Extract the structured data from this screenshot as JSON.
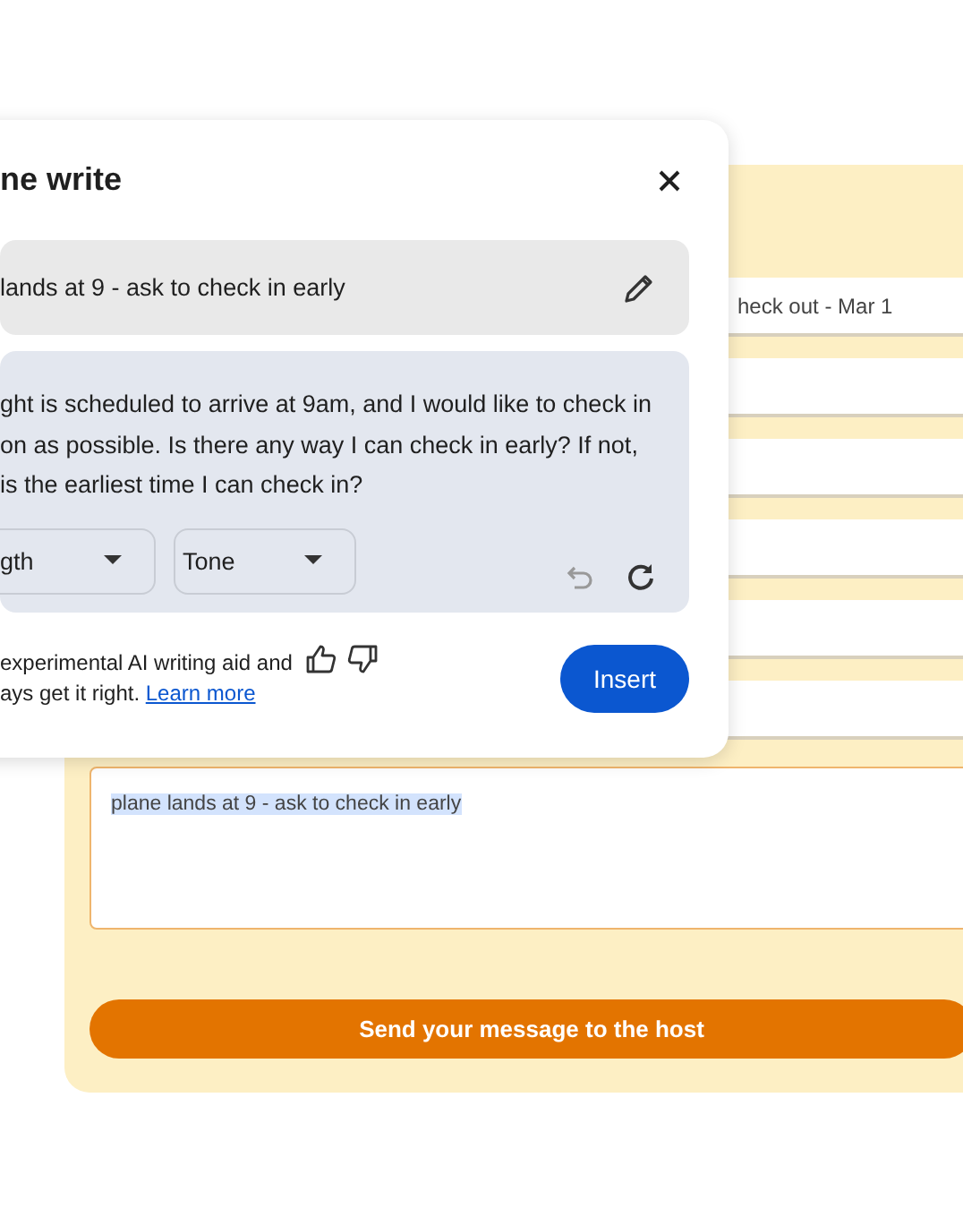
{
  "form": {
    "fields": [
      {
        "kind": "filled",
        "value": "heck out - Mar 1"
      },
      {
        "kind": "empty"
      },
      {
        "kind": "empty"
      },
      {
        "kind": "empty"
      },
      {
        "kind": "empty"
      },
      {
        "kind": "empty"
      }
    ],
    "message": {
      "value": "plane lands at 9 - ask to check in early",
      "highlighted": true
    },
    "send_button": "Send your message to the host"
  },
  "dialog": {
    "title": "ne write",
    "prompt": "lands at 9 - ask to check in early",
    "result_lines": [
      "ght is scheduled to arrive at 9am, and I would like to check in",
      "on as possible. Is there any way I can check in early? If not,",
      "is the earliest time I can check in?"
    ],
    "dropdowns": [
      "gth",
      "Tone"
    ],
    "disclaimer_lines": [
      "experimental AI writing aid and",
      "ays get it right."
    ],
    "learn_more": "Learn more",
    "insert": "Insert"
  }
}
